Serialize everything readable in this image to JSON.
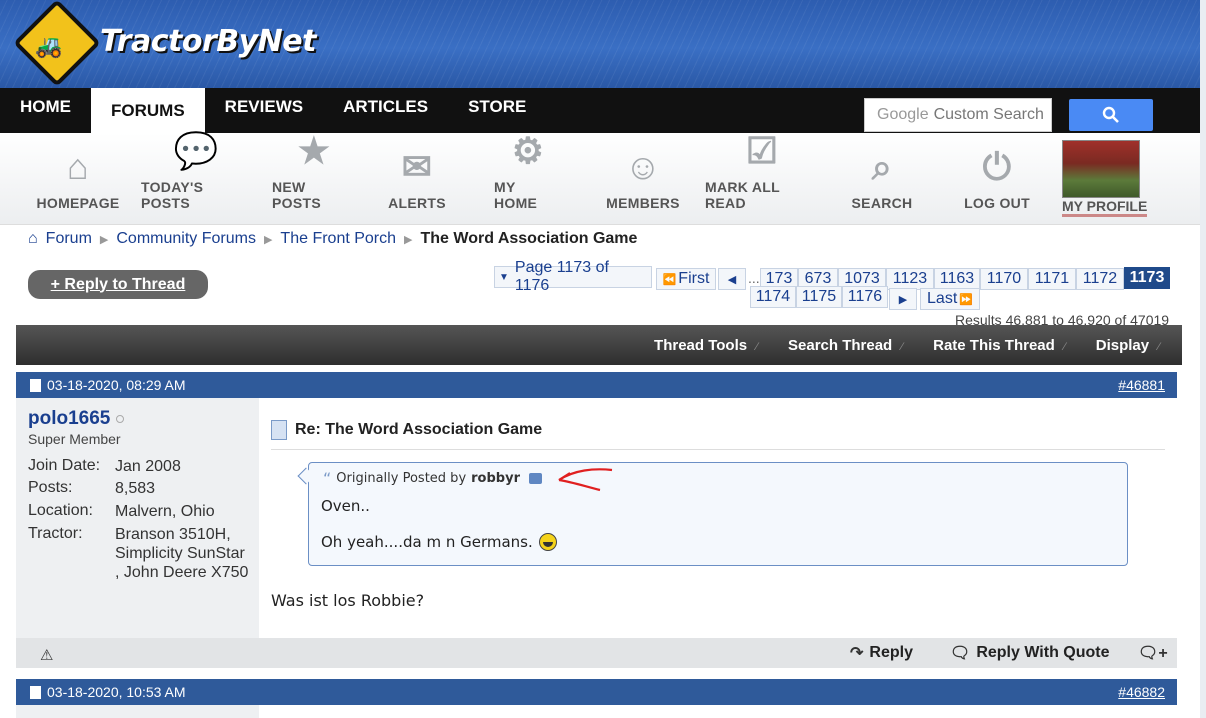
{
  "site": {
    "name": "TractorByNet"
  },
  "topnav": {
    "tabs": [
      "HOME",
      "FORUMS",
      "REVIEWS",
      "ARTICLES",
      "STORE"
    ],
    "active": "FORUMS"
  },
  "search": {
    "placeholder": "Custom Search",
    "brand": "Google"
  },
  "iconbar": {
    "items": [
      {
        "label": "HOMEPAGE",
        "icon": "house-icon"
      },
      {
        "label": "TODAY'S POSTS",
        "icon": "chat-bubbles-icon"
      },
      {
        "label": "NEW POSTS",
        "icon": "star-bubble-icon"
      },
      {
        "label": "ALERTS",
        "icon": "envelope-icon"
      },
      {
        "label": "MY HOME",
        "icon": "gear-icon"
      },
      {
        "label": "MEMBERS",
        "icon": "people-icon"
      },
      {
        "label": "MARK ALL READ",
        "icon": "checklist-icon"
      },
      {
        "label": "SEARCH",
        "icon": "magnifier-icon"
      },
      {
        "label": "LOG OUT",
        "icon": "power-icon"
      }
    ],
    "profile_label": "MY PROFILE"
  },
  "breadcrumb": {
    "items": [
      "Forum",
      "Community Forums",
      "The Front Porch"
    ],
    "current": "The Word Association Game"
  },
  "reply_thread_label": "+ Reply to Thread",
  "pagination": {
    "page_label": "Page 1173 of 1176",
    "first_label": "First",
    "last_label": "Last",
    "ellipsis": "...",
    "pages_row1": [
      "173",
      "673",
      "1073",
      "1123",
      "1163",
      "1170",
      "1171",
      "1172"
    ],
    "current": "1173",
    "pages_row2": [
      "1174",
      "1175",
      "1176"
    ]
  },
  "results_text": "Results 46,881 to 46,920 of 47019",
  "thread_toolbar": {
    "items": [
      "Thread Tools",
      "Search Thread",
      "Rate This Thread",
      "Display"
    ]
  },
  "posts": [
    {
      "date": "03-18-2020, 08:29 AM",
      "number": "#46881",
      "username": "polo1665",
      "user_title": "Super Member",
      "fields": [
        {
          "label": "Join Date:",
          "value": "Jan 2008"
        },
        {
          "label": "Posts:",
          "value": "8,583"
        },
        {
          "label": "Location:",
          "value": "Malvern, Ohio"
        },
        {
          "label": "Tractor:",
          "value": "Branson 3510H, Simplicity SunStar , John Deere X750"
        }
      ],
      "title": "Re: The Word Association Game",
      "quote": {
        "prefix": "Originally Posted by",
        "author": "robbyr",
        "line1": "Oven..",
        "line2": "Oh yeah....da m n Germans."
      },
      "text": "Was ist los Robbie?",
      "actions": {
        "reply": "Reply",
        "reply_quote": "Reply With Quote"
      }
    },
    {
      "date": "03-18-2020, 10:53 AM",
      "number": "#46882"
    }
  ],
  "colors": {
    "header_blue": "#2f5a9a",
    "link": "#1a3f8f",
    "nav_black": "#111111",
    "search_blue": "#4a8af4"
  }
}
